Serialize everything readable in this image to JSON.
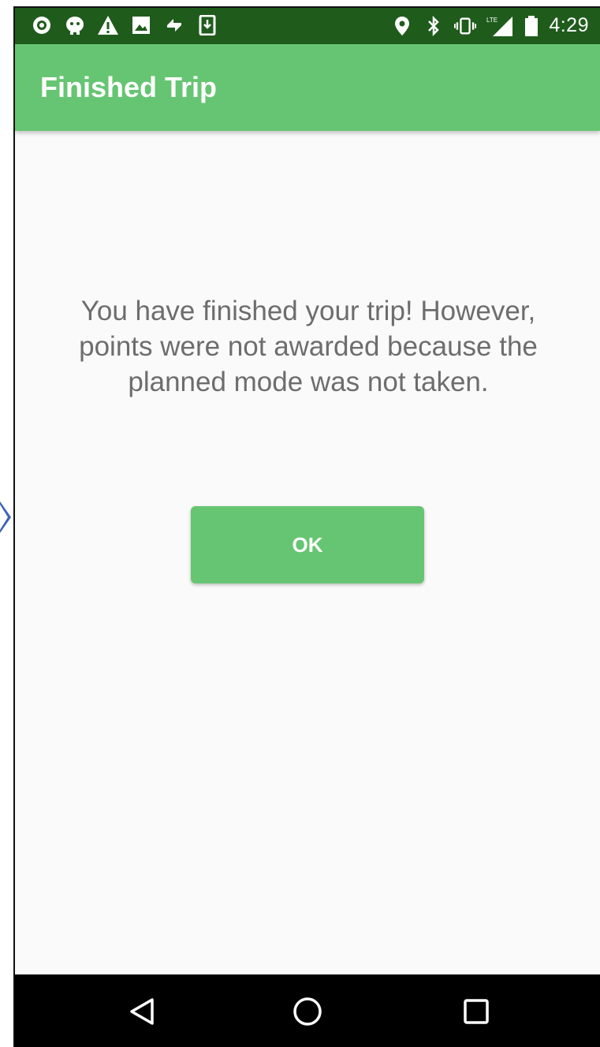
{
  "status_bar": {
    "time": "4:29",
    "left_icons": [
      "notification-a-icon",
      "notification-b-icon",
      "warning-icon",
      "image-icon",
      "sync-icon",
      "download-icon"
    ],
    "right_icons": [
      "location-icon",
      "bluetooth-icon",
      "vibrate-icon",
      "lte-signal-icon",
      "battery-icon"
    ],
    "lte_label": "LTE",
    "background": "#1f5c1c"
  },
  "app_bar": {
    "title": "Finished Trip",
    "color": "#66c572"
  },
  "main": {
    "message": "You have finished your trip! However, points were not awarded because the planned mode was not taken.",
    "ok_label": "OK"
  },
  "nav_bar": {
    "buttons": [
      "back-icon",
      "home-icon",
      "recents-icon"
    ]
  }
}
